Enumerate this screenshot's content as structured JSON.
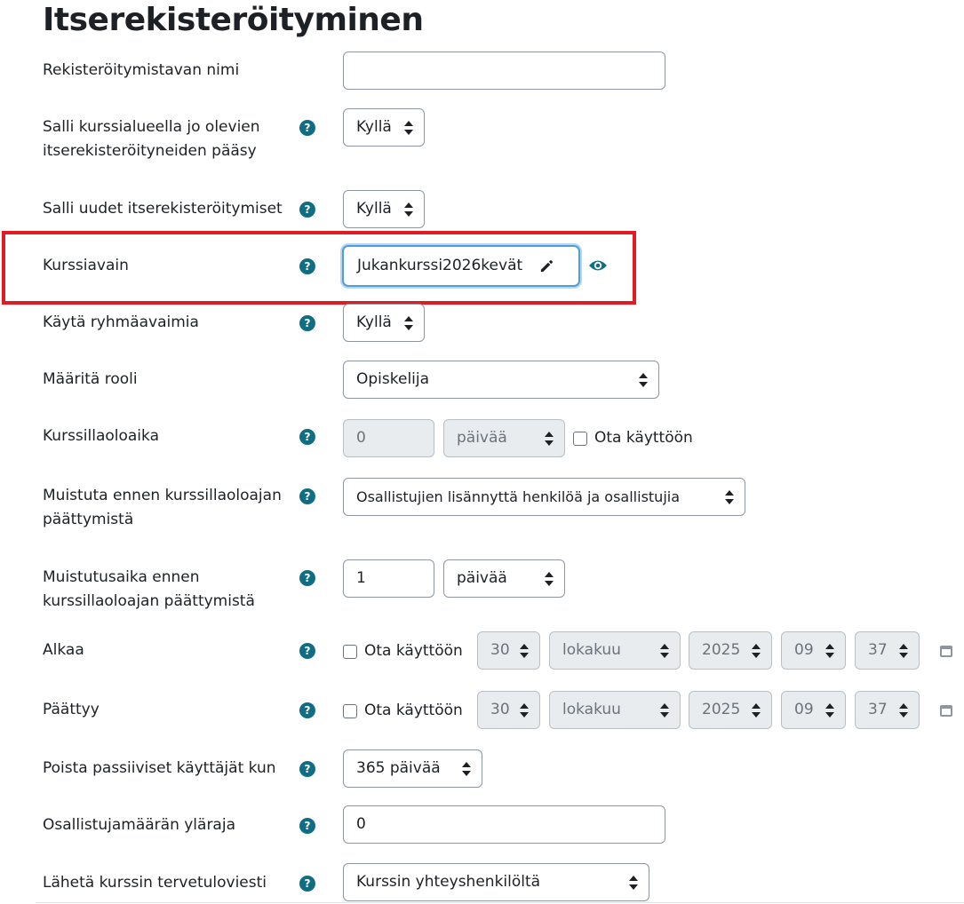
{
  "page_title": "Itserekisteröityminen",
  "help_glyph": "?",
  "fields": {
    "method_name": {
      "label": "Rekisteröitymistavan nimi",
      "value": ""
    },
    "allow_existing": {
      "label_line1": "Salli kurssialueella jo olevien",
      "label_line2": "itserekisteröityneiden pääsy",
      "value": "Kyllä"
    },
    "allow_new": {
      "label": "Salli uudet itserekisteröitymiset",
      "value": "Kyllä"
    },
    "enrolment_key": {
      "label": "Kurssiavain",
      "value": "Jukankurssi2026kevät"
    },
    "group_keys": {
      "label": "Käytä ryhmäavaimia",
      "value": "Kyllä"
    },
    "role": {
      "label": "Määritä rooli",
      "value": "Opiskelija"
    },
    "duration": {
      "label": "Kurssillaoloaika",
      "value": "0",
      "unit": "päivää",
      "enable_label": "Ota käyttöön"
    },
    "notify": {
      "label_line1": "Muistuta ennen kurssillaoloajan",
      "label_line2": "päättymistä",
      "value": "Osallistujien lisännyttä henkilöä ja osallistujia"
    },
    "notify_threshold": {
      "label_line1": "Muistutusaika ennen",
      "label_line2": "kurssillaoloajan päättymistä",
      "value": "1",
      "unit": "päivää"
    },
    "start": {
      "label": "Alkaa",
      "enable_label": "Ota käyttöön",
      "day": "30",
      "month": "lokakuu",
      "year": "2025",
      "hour": "09",
      "minute": "37"
    },
    "end": {
      "label": "Päättyy",
      "enable_label": "Ota käyttöön",
      "day": "30",
      "month": "lokakuu",
      "year": "2025",
      "hour": "09",
      "minute": "37"
    },
    "remove_inactive": {
      "label": "Poista passiiviset käyttäjät kun",
      "value": "365 päivää"
    },
    "max_enrolled": {
      "label": "Osallistujamäärän yläraja",
      "value": "0"
    },
    "welcome_message": {
      "label": "Lähetä kurssin tervetuloviesti",
      "value": "Kurssin yhteyshenkilöltä"
    }
  },
  "colors": {
    "help_icon": "#0f6e84",
    "highlight_box": "#e01b24",
    "focus_border": "#4f9ed6"
  },
  "icons": [
    "help-icon",
    "edit-pencil-icon",
    "reveal-eye-icon",
    "calendar-icon",
    "select-arrows-icon"
  ]
}
